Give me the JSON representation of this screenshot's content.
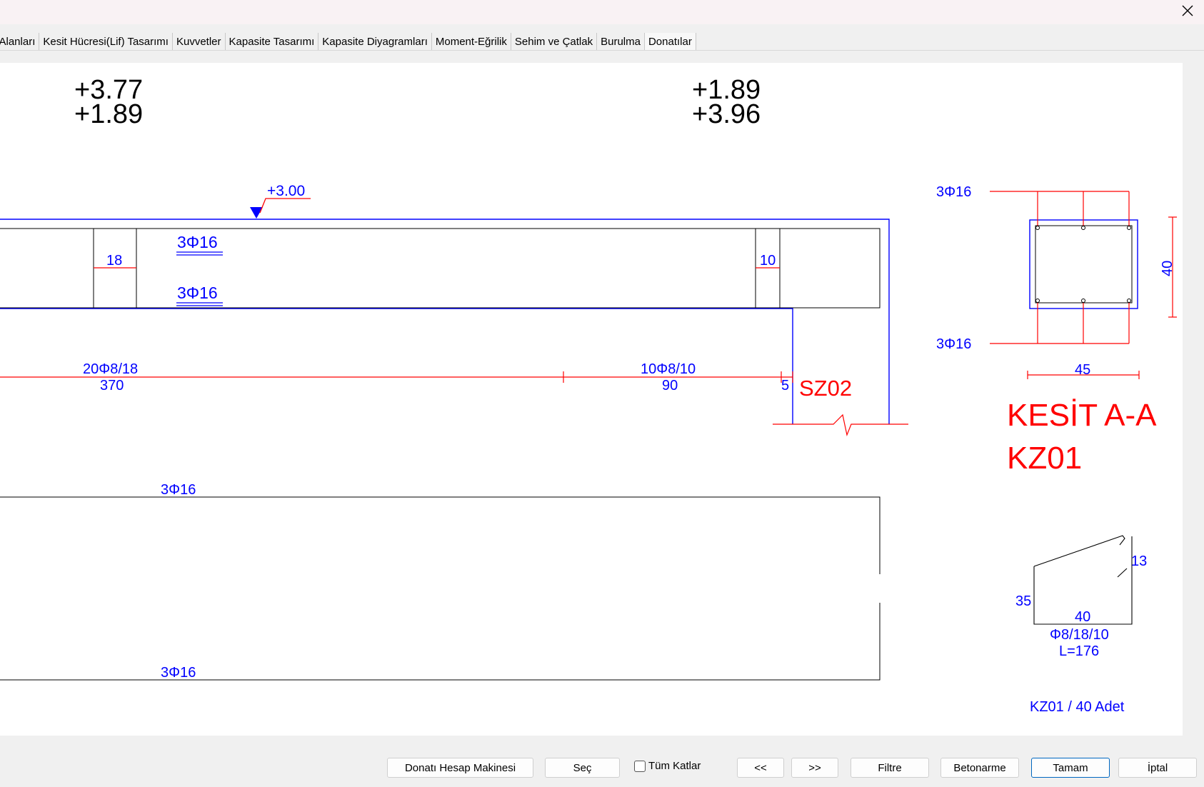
{
  "tabs": [
    "ı Alanları",
    "Kesit Hücresi(Lif) Tasarımı",
    "Kuvvetler",
    "Kapasite Tasarımı",
    "Kapasite Diyagramları",
    "Moment-Eğrilik",
    "Sehim ve Çatlak",
    "Burulma",
    "Donatılar"
  ],
  "drawing": {
    "top_values_left": [
      "+3.77",
      "+1.89"
    ],
    "top_values_right": [
      "+1.89",
      "+3.96"
    ],
    "elevation": "+3.00",
    "top_bar_label": "3Φ16",
    "bottom_bar_label": "3Φ16",
    "dim_left": "18",
    "dim_right": "10",
    "stirrup_left_spec": "20Φ8/18",
    "stirrup_left_len": "370",
    "stirrup_right_spec": "10Φ8/10",
    "stirrup_right_len": "90",
    "end_dim": "5",
    "support_label": "SZ02",
    "lower_top_label": "3Φ16",
    "lower_bottom_label": "3Φ16"
  },
  "section": {
    "top_bars": "3Φ16",
    "bottom_bars": "3Φ16",
    "height": "40",
    "width": "45",
    "title": "KESİT A-A",
    "name": "KZ01"
  },
  "stirrup": {
    "hook": "13",
    "side": "35",
    "bottom": "40",
    "spec": "Φ8/18/10",
    "length": "L=176",
    "summary": "KZ01 / 40 Adet"
  },
  "buttons": {
    "calculator": "Donatı Hesap Makinesi",
    "select": "Seç",
    "all_floors": "Tüm Katlar",
    "prev": "<<",
    "next": ">>",
    "filter": "Filtre",
    "concrete": "Betonarme",
    "ok": "Tamam",
    "cancel": "İptal"
  },
  "colors": {
    "blue": "#0000ff",
    "red": "#ff0000",
    "black": "#000000"
  }
}
